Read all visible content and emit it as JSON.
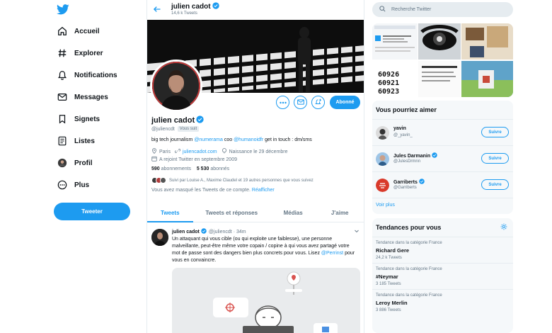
{
  "nav": {
    "items": [
      {
        "label": "Accueil",
        "icon": "home-icon"
      },
      {
        "label": "Explorer",
        "icon": "hashtag-icon"
      },
      {
        "label": "Notifications",
        "icon": "bell-icon"
      },
      {
        "label": "Messages",
        "icon": "envelope-icon"
      },
      {
        "label": "Signets",
        "icon": "bookmark-icon"
      },
      {
        "label": "Listes",
        "icon": "list-icon"
      },
      {
        "label": "Profil",
        "icon": "avatar-icon"
      },
      {
        "label": "Plus",
        "icon": "more-icon"
      }
    ],
    "tweet_button": "Tweeter"
  },
  "header": {
    "name": "julien cadot",
    "tweet_count": "14,6 k Tweets"
  },
  "profile": {
    "name": "julien cadot",
    "handle": "@juliencdt",
    "follows_you": "Vous suit",
    "follow_button": "Abonné",
    "bio_prefix": "big tech journalism ",
    "bio_link1": "@numerama",
    "bio_mid": " coo ",
    "bio_link2": "@humanoidfr",
    "bio_suffix": " get in touch : dm/sms",
    "location": "Paris",
    "website": "juliencadot.com",
    "birth": "Naissance le 29 décembre",
    "joined": "A rejoint Twitter en septembre 2009",
    "following_count": "590",
    "following_label": "abonnements",
    "followers_count": "5 530",
    "followers_label": "abonnés",
    "followed_by": "Suivi par Louise A., Maxime Claudel et 19 autres personnes que vous suivez",
    "muted_note": "Vous avez masqué les Tweets de ce compte.",
    "unmute_link": "Réafficher"
  },
  "tabs": [
    "Tweets",
    "Tweets et réponses",
    "Médias",
    "J'aime"
  ],
  "tweet": {
    "name": "julien cadot",
    "handle": "@juliencdt",
    "time": "· 34m",
    "text": "Un attaquant qui vous cible (ou qui exploite une faiblesse), une personne malveillante, peut-être même votre copain / copine à qui vous avez partagé votre mot de passe sont des dangers bien plus concrets pour vous. Lisez ",
    "mention": "@Perrinst",
    "text_end": " pour vous en convaincre."
  },
  "search": {
    "placeholder": "Recherche Twitter"
  },
  "media_grid": {
    "phone_numbers": [
      "60926",
      "60921",
      "60923"
    ]
  },
  "suggestions": {
    "title": "Vous pourriez aimer",
    "items": [
      {
        "name": "yavin",
        "handle": "@_yavin_",
        "verified": false,
        "button": "Suivre"
      },
      {
        "name": "Jules Darmanin",
        "handle": "@JulesDrmnn",
        "verified": true,
        "button": "Suivre"
      },
      {
        "name": "Garriberts",
        "handle": "@Garriberts",
        "verified": true,
        "button": "Suivre"
      }
    ],
    "see_more": "Voir plus"
  },
  "trends": {
    "title": "Tendances pour vous",
    "items": [
      {
        "context": "Tendance dans la catégorie France",
        "title": "Richard Gere",
        "count": "24,2 k Tweets"
      },
      {
        "context": "Tendance dans la catégorie France",
        "title": "#Neymar",
        "count": "3 185 Tweets"
      },
      {
        "context": "Tendance dans la catégorie France",
        "title": "Leroy Merlin",
        "count": "3 886 Tweets"
      }
    ]
  },
  "colors": {
    "accent": "#1d9bf0",
    "muted": "#657786",
    "border": "#e6ecf0"
  }
}
